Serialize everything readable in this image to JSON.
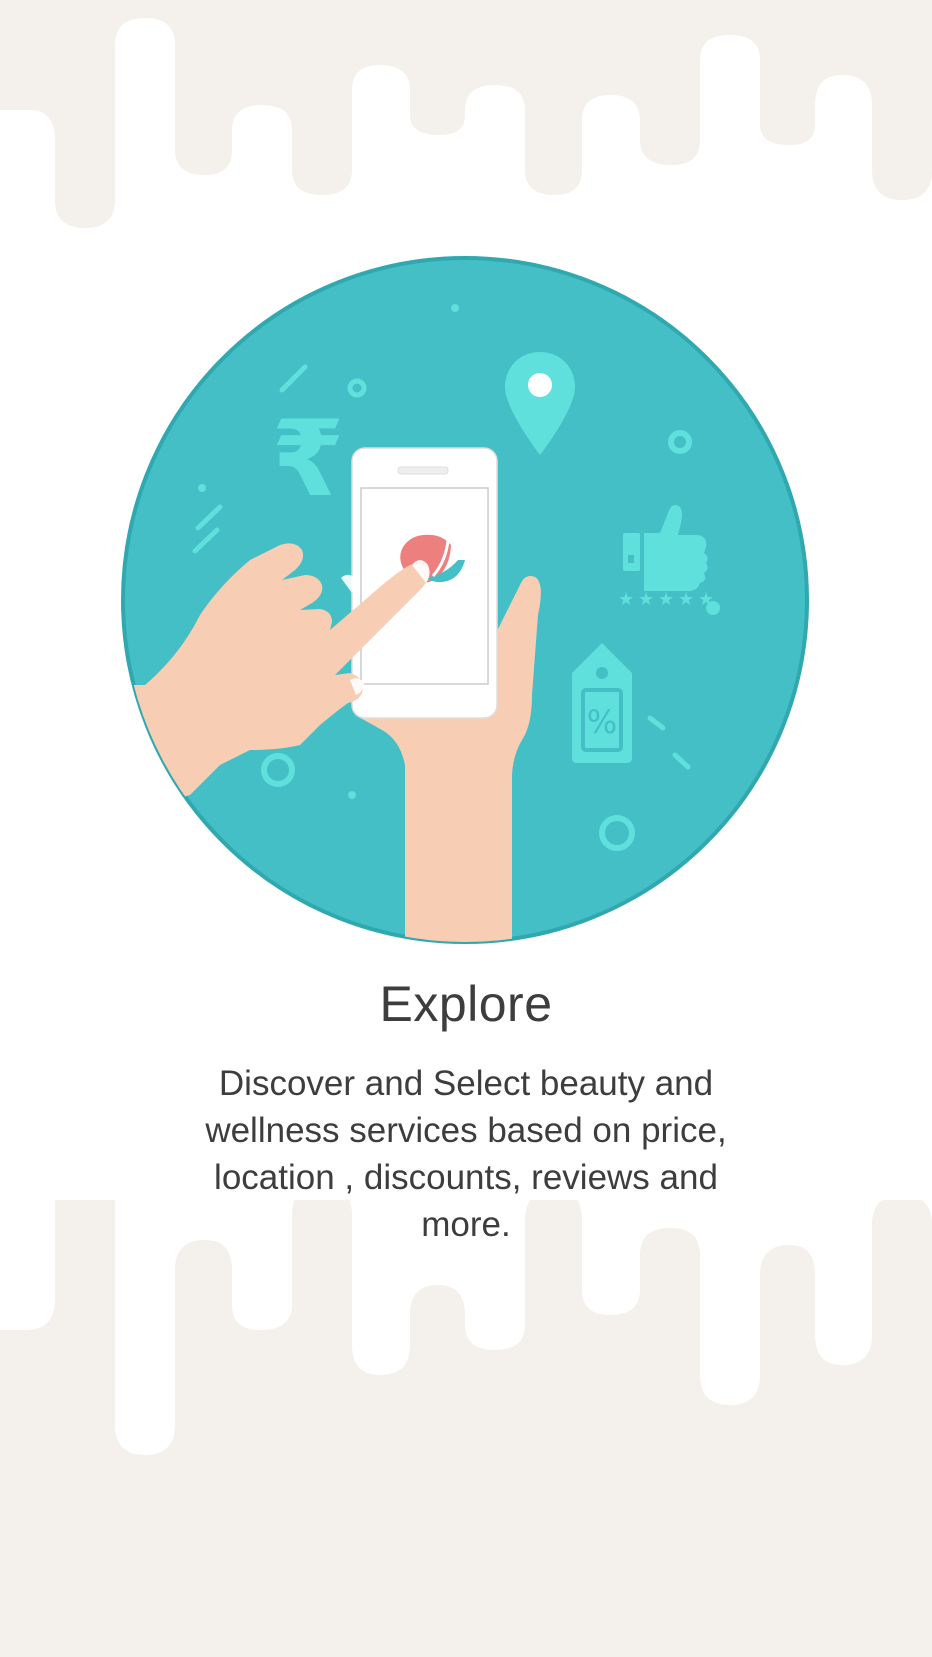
{
  "onboarding": {
    "title": "Explore",
    "description": "Discover and Select beauty and wellness services based on price, location , discounts, reviews and more."
  },
  "illustration": {
    "icons": [
      "rupee-icon",
      "location-pin-icon",
      "thumbs-up-icon",
      "rating-stars-icon",
      "discount-tag-icon",
      "smartphone-icon",
      "app-logo-icon",
      "hand-icon"
    ],
    "rupee_symbol": "₹",
    "percent_symbol": "%"
  },
  "colors": {
    "background": "#ffffff",
    "drip": "#f4f0eb",
    "circle": "#43bfc5",
    "circle_border": "#2fa9af",
    "icon_accent": "#5fe0dc",
    "skin": "#f7cdb4",
    "logo": "#ee7f7f",
    "text": "#3d3d3d"
  }
}
